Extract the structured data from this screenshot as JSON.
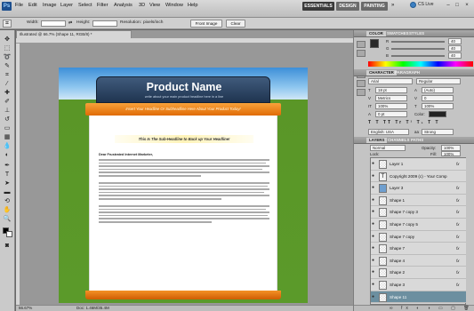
{
  "menubar": {
    "app_logo": "Ps",
    "items": [
      "File",
      "Edit",
      "Image",
      "Layer",
      "Select",
      "Filter",
      "Analysis",
      "3D",
      "View",
      "Window",
      "Help"
    ],
    "workspaces": [
      "ESSENTIALS",
      "DESIGN",
      "PAINTING"
    ],
    "more": "»",
    "cslive": "CS Live",
    "win_controls": [
      "–",
      "□",
      "×"
    ]
  },
  "options": {
    "width_label": "Width:",
    "height_label": "Height:",
    "resolution_label": "Resolution:",
    "unit": "pixels/inch",
    "front_image": "Front Image",
    "clear": "Clear"
  },
  "document": {
    "tab_title": "Illustrated @ 66.7% (Shape 11, RGB/8) *",
    "zoom": "66.67%",
    "doc_size": "Doc: 1.46M/35.4M"
  },
  "artwork": {
    "product_name": "Product Name",
    "product_tagline": "write about your main product headline here in a line",
    "orange_headline": "Insert Your Headline Or Subheadline Here About Your Product Today!",
    "subheadline": "This Is The Sub-Headline to Back up Your Headline!",
    "dear": "Dear Frustrated Internet Marketer,"
  },
  "panels": {
    "color_tabs": [
      "COLOR",
      "SWATCHES",
      "STYLES"
    ],
    "rgb": [
      {
        "ch": "R",
        "val": "40"
      },
      {
        "ch": "G",
        "val": "40"
      },
      {
        "ch": "B",
        "val": "40"
      }
    ],
    "char_tabs": [
      "CHARACTER",
      "PARAGRAPH"
    ],
    "font_family": "Arial",
    "font_style": "Regular",
    "font_size": "18 pt",
    "leading": "(Auto)",
    "tracking": "0",
    "kerning": "Metrics",
    "vscale": "100%",
    "hscale": "100%",
    "baseline": "0 pt",
    "color_label": "Color:",
    "language": "English: USA",
    "aa_label": "aa",
    "aa": "Strong",
    "layers_tabs": [
      "LAYERS",
      "CHANNELS",
      "PATHS"
    ],
    "blend_mode": "Normal",
    "opacity_label": "Opacity:",
    "opacity": "100%",
    "lock_label": "Lock:",
    "fill_label": "Fill:",
    "fill": "100%"
  },
  "layers": [
    {
      "name": "Layer 1",
      "type": "pixel",
      "fx": true
    },
    {
      "name": "Copyright 2009 (c) - Your Comp",
      "type": "text",
      "fx": false
    },
    {
      "name": "Layer 3",
      "type": "pixel",
      "fx": true
    },
    {
      "name": "Shape 1",
      "type": "shape",
      "fx": true
    },
    {
      "name": "Shape 7 copy 3",
      "type": "shape",
      "fx": true
    },
    {
      "name": "Shape 7 copy 5",
      "type": "shape",
      "fx": true
    },
    {
      "name": "Shape 7 copy",
      "type": "shape",
      "fx": true
    },
    {
      "name": "Shape 7",
      "type": "shape",
      "fx": true
    },
    {
      "name": "Shape 4",
      "type": "shape",
      "fx": true
    },
    {
      "name": "Shape 2",
      "type": "shape",
      "fx": true
    },
    {
      "name": "Shape 3",
      "type": "shape",
      "fx": true
    },
    {
      "name": "Shape 11",
      "type": "shape",
      "fx": false,
      "selected": true
    }
  ],
  "colors": {
    "accent_orange": "#e77a10",
    "header_navy": "#2a405d",
    "grass": "#5b9a2a",
    "sky": "#8ec6ef"
  }
}
